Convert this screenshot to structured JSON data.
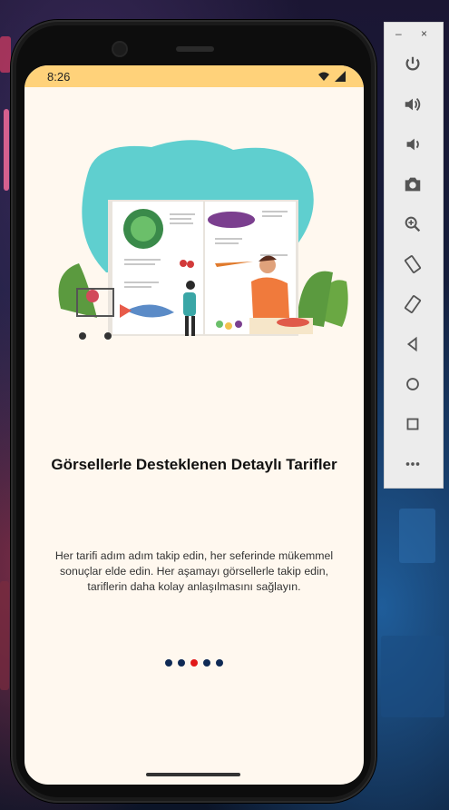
{
  "status": {
    "time": "8:26"
  },
  "onboarding": {
    "title": "Görsellerle Desteklenen Detaylı Tarifler",
    "description": "Her tarifi adım adım takip edin, her seferinde mükemmel sonuçlar elde edin. Her aşamayı görsellerle takip edin, tariflerin daha kolay anlaşılmasını sağlayın.",
    "dots_total": 5,
    "active_dot": 3,
    "colors": {
      "status_bar": "#ffd27a",
      "background": "#fff8ef",
      "dot": "#0f2a55",
      "dot_active": "#e11919"
    }
  },
  "emulator_panel": {
    "minimize": "–",
    "close": "×",
    "buttons": [
      "power-icon",
      "volume-up-icon",
      "volume-down-icon",
      "camera-icon",
      "zoom-icon",
      "rotate-left-icon",
      "rotate-right-icon",
      "back-icon",
      "home-icon",
      "overview-icon",
      "more-icon"
    ]
  }
}
